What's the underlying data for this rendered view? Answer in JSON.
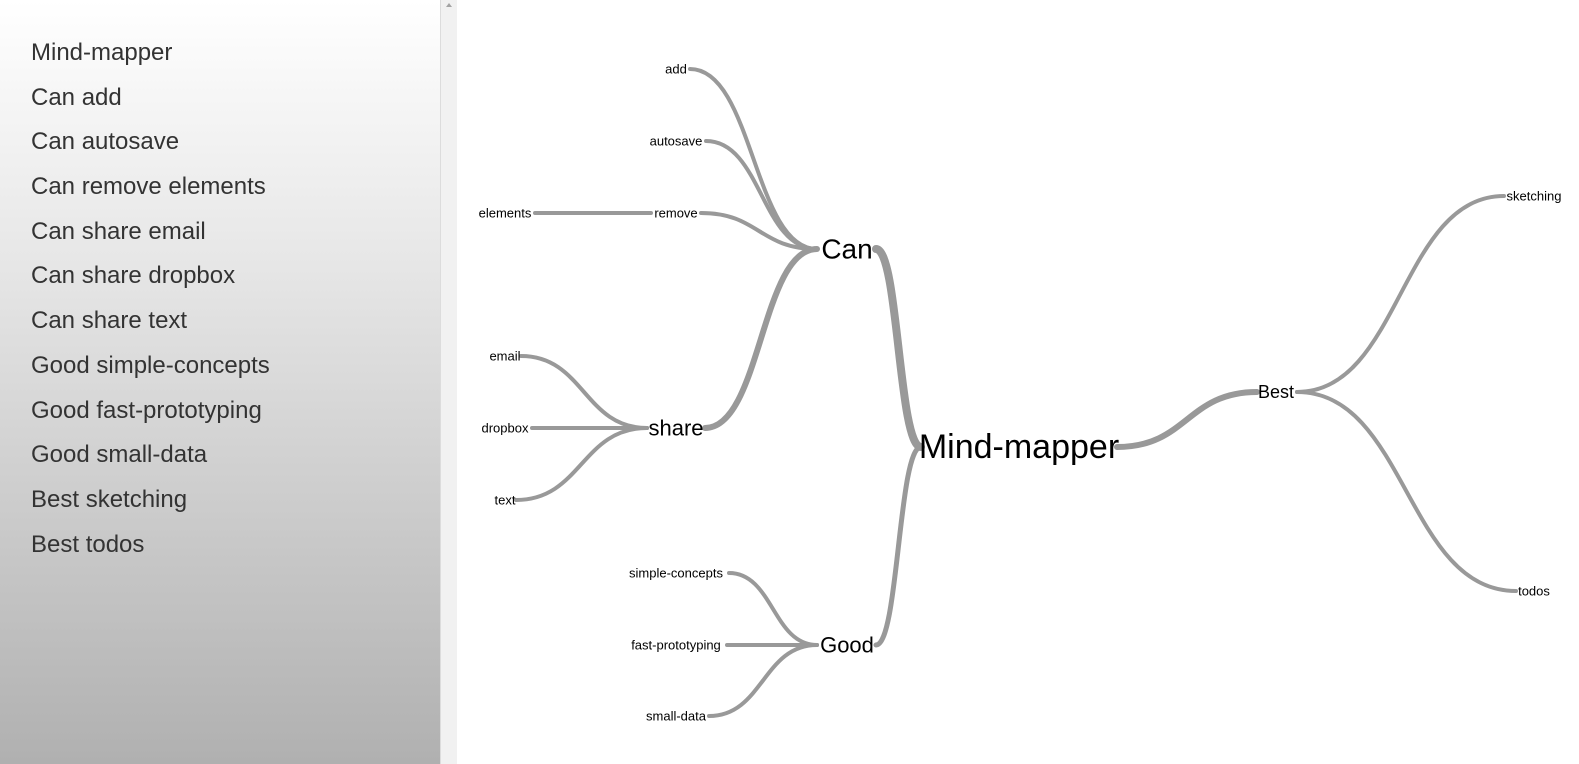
{
  "sidebar": {
    "items": [
      "Mind-mapper",
      "Can add",
      "Can autosave",
      "Can remove elements",
      "Can share email",
      "Can share dropbox",
      "Can share text",
      "Good simple-concepts",
      "Good fast-prototyping",
      "Good small-data",
      "Best sketching",
      "Best todos"
    ]
  },
  "mindmap": {
    "root": {
      "label": "Mind-mapper",
      "children": [
        {
          "label": "Can",
          "children": [
            {
              "label": "add"
            },
            {
              "label": "autosave"
            },
            {
              "label": "remove",
              "children": [
                {
                  "label": "elements"
                }
              ]
            },
            {
              "label": "share",
              "children": [
                {
                  "label": "email"
                },
                {
                  "label": "dropbox"
                },
                {
                  "label": "text"
                }
              ]
            }
          ]
        },
        {
          "label": "Good",
          "children": [
            {
              "label": "simple-concepts"
            },
            {
              "label": "fast-prototyping"
            },
            {
              "label": "small-data"
            }
          ]
        },
        {
          "label": "Best",
          "children": [
            {
              "label": "sketching"
            },
            {
              "label": "todos"
            }
          ]
        }
      ]
    },
    "colors": {
      "edge": "#999999",
      "text": "#000000"
    }
  }
}
